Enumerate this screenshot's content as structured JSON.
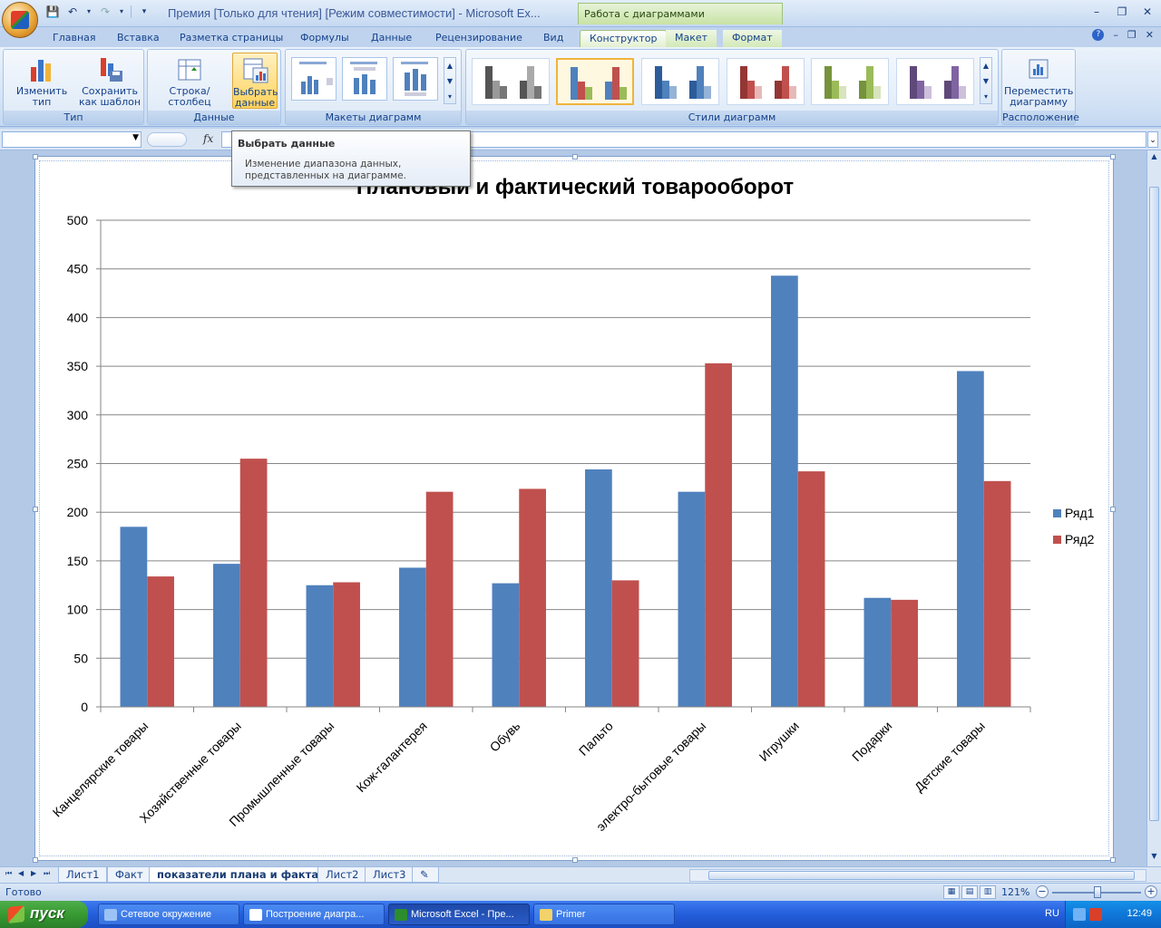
{
  "window": {
    "title": "Премия  [Только для чтения]  [Режим совместимости]  -  Microsoft Ex...",
    "contextual_title": "Работа с диаграммами"
  },
  "tabs": [
    {
      "label": "Главная"
    },
    {
      "label": "Вставка"
    },
    {
      "label": "Разметка страницы"
    },
    {
      "label": "Формулы"
    },
    {
      "label": "Данные"
    },
    {
      "label": "Рецензирование"
    },
    {
      "label": "Вид"
    },
    {
      "label": "Конструктор"
    },
    {
      "label": "Макет"
    },
    {
      "label": "Формат"
    }
  ],
  "ribbon": {
    "type_group": {
      "label": "Тип",
      "change_type": "Изменить тип диаграммы",
      "save_template": "Сохранить как шаблон"
    },
    "data_group": {
      "label": "Данные",
      "switch_row_col": "Строка/столбец",
      "select_data": "Выбрать данные"
    },
    "layouts_group": {
      "label": "Макеты диаграмм"
    },
    "styles_group": {
      "label": "Стили диаграмм"
    },
    "location_group": {
      "label": "Расположение",
      "move_chart": "Переместить диаграмму"
    }
  },
  "formula_bar": {
    "fx": "fx"
  },
  "tooltip": {
    "title": "Выбрать данные",
    "body": "Изменение диапазона данных, представленных на диаграмме."
  },
  "colors": {
    "series1": "#4f81bd",
    "series2": "#c0504d"
  },
  "chart_data": {
    "type": "bar",
    "title": "Плановый и фактический товарооборот",
    "categories": [
      "Канцелярские товары",
      "Хозяйственные товары",
      "Промышленные товары",
      "Кож-галантерея",
      "Обувь",
      "Пальто",
      "электро-бытовые товары",
      "Игрушки",
      "Подарки",
      "Детские товары"
    ],
    "series": [
      {
        "name": "Ряд1",
        "values": [
          185,
          147,
          125,
          143,
          127,
          244,
          221,
          443,
          112,
          345
        ]
      },
      {
        "name": "Ряд2",
        "values": [
          134,
          255,
          128,
          221,
          224,
          130,
          353,
          242,
          110,
          232
        ]
      }
    ],
    "ylim": [
      0,
      500
    ],
    "yticks": [
      0,
      50,
      100,
      150,
      200,
      250,
      300,
      350,
      400,
      450,
      500
    ],
    "grid": true,
    "legend": "right"
  },
  "sheet_tabs": [
    "Лист1",
    "Факт",
    "показатели плана и факта",
    "Лист2",
    "Лист3"
  ],
  "active_sheet": "показатели плана и факта",
  "status": {
    "ready": "Готово",
    "zoom": "121%"
  },
  "taskbar": {
    "start": "пуск",
    "items": [
      "Сетевое окружение",
      "Построение диагра...",
      "Microsoft Excel - Пре...",
      "Primer"
    ],
    "lang": "RU",
    "clock": "12:49"
  }
}
